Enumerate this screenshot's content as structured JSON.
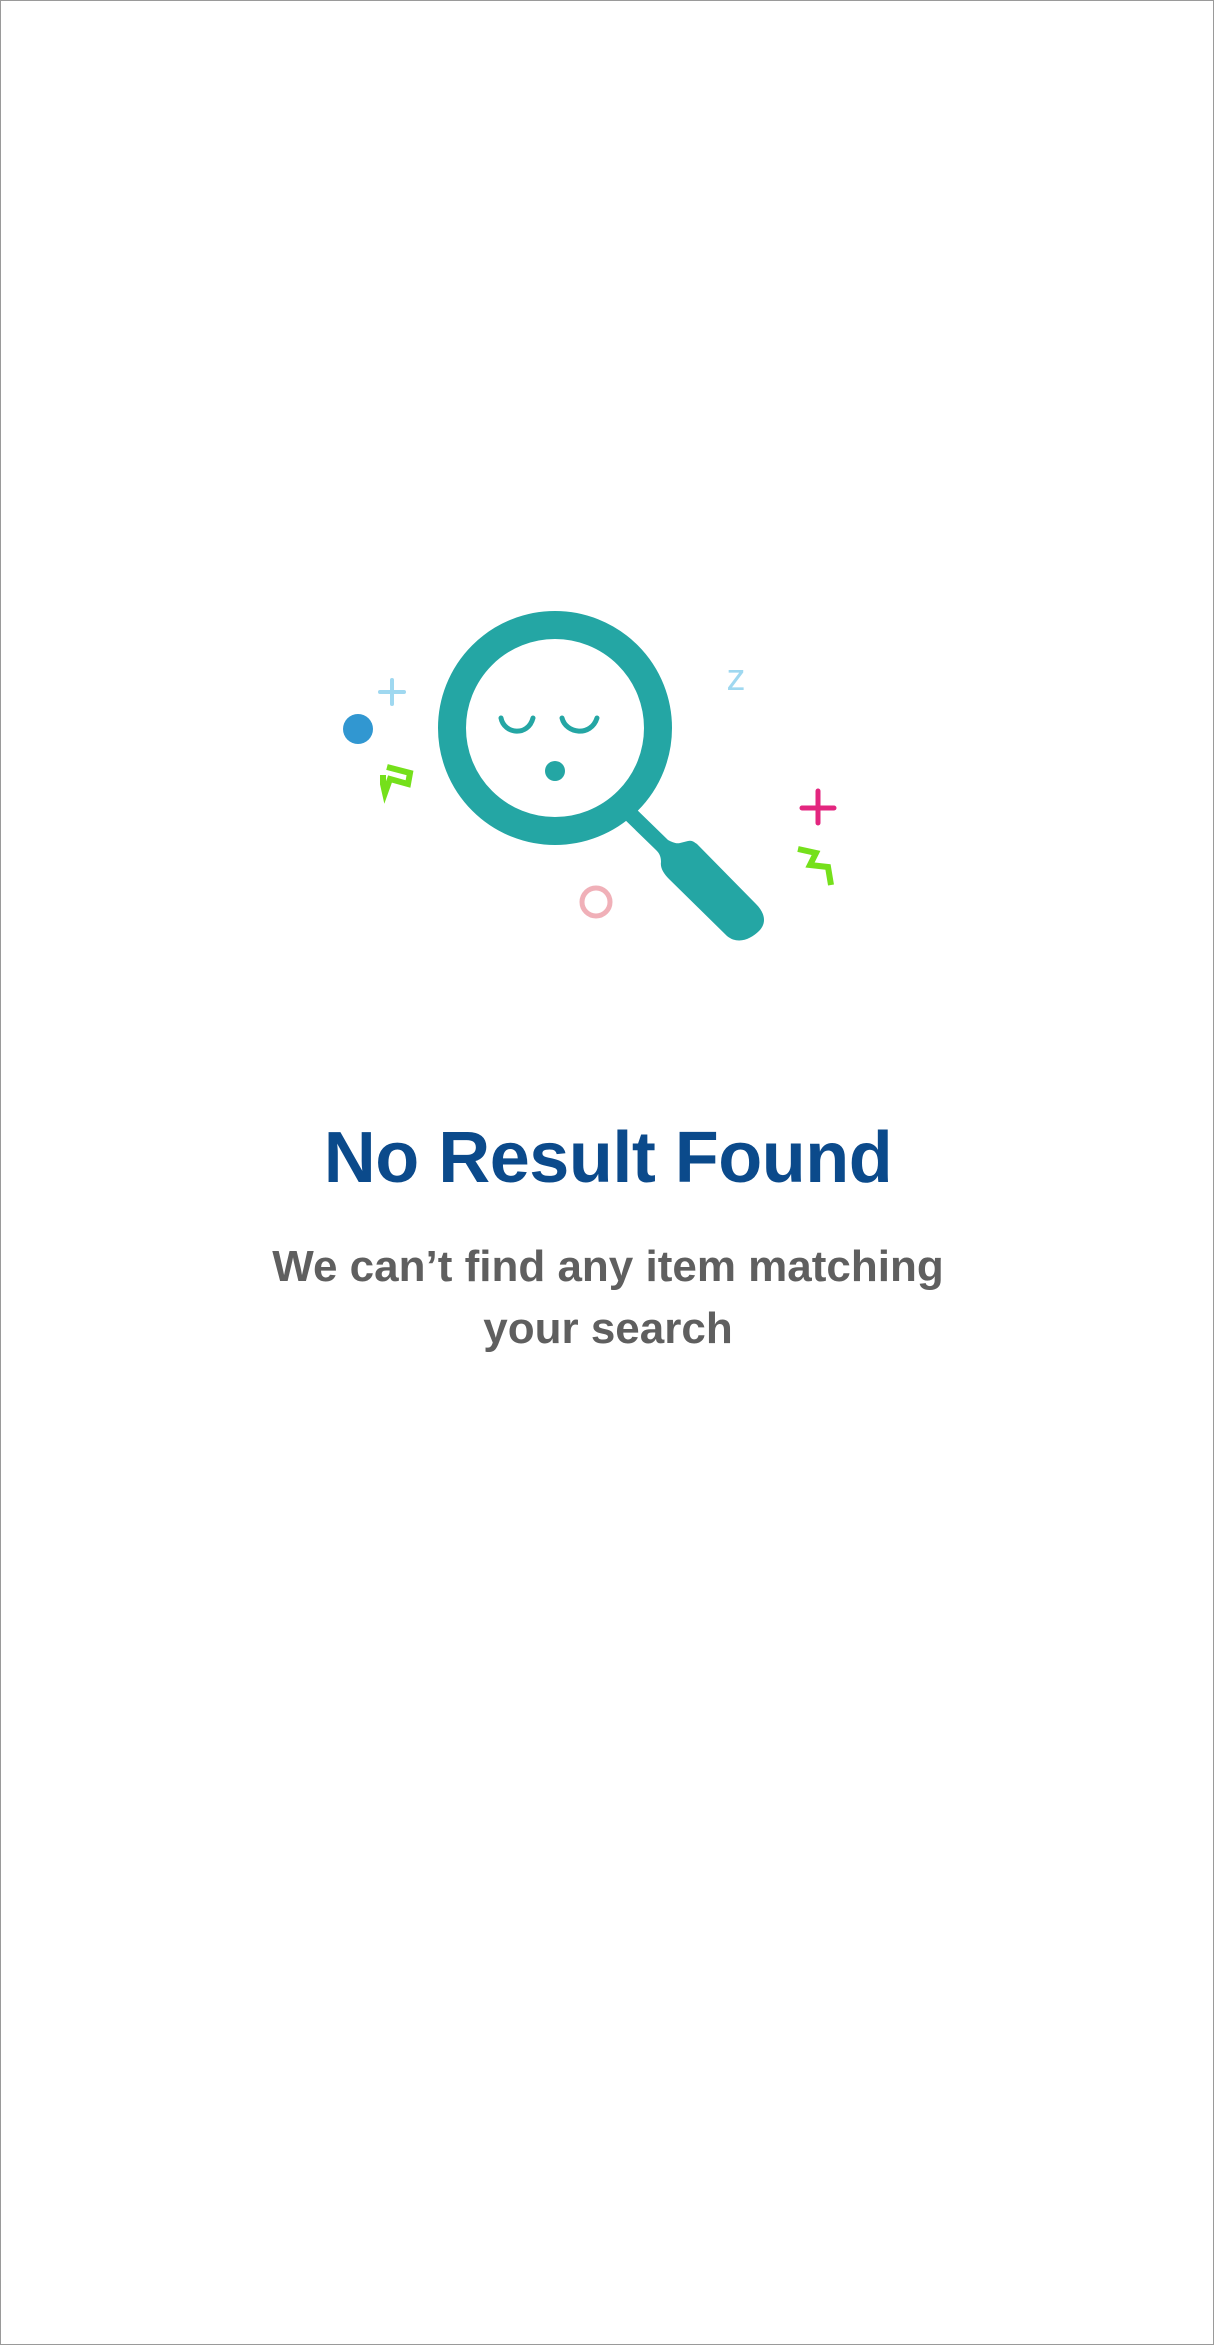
{
  "empty_state": {
    "title": "No Result Found",
    "message": "We can’t find any item matching your search"
  },
  "illustration": {
    "icon": "sleeping-magnifying-glass-icon",
    "decorations": [
      "sparkle-plus-icon",
      "dot-icon",
      "zigzag-icon",
      "z-letter-icon",
      "ring-icon"
    ]
  },
  "colors": {
    "background": "#ffffff",
    "title": "#0b4a8b",
    "message": "#5f5f5f",
    "teal": "#24a6a4",
    "light_blue": "#9fd8f0",
    "blue_dot": "#3197d1",
    "lime": "#75e01b",
    "pink": "#e3267f",
    "ring": "#f0b0b8"
  },
  "text": {
    "sleep_letter": "z"
  }
}
